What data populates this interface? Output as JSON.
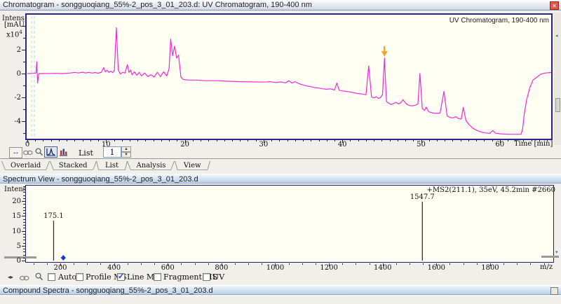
{
  "chromatogram_pane": {
    "title": "Chromatogram - songguoqiang_55%-2_pos_3_01_203.d: UV Chromatogram, 190-400 nm",
    "close_glyph": "✕",
    "plot_label": "UV Chromatogram, 190-400 nm",
    "y_label_1": "Intens.",
    "y_label_2": "[mAU]",
    "y_scale_base": "x10",
    "y_scale_exp": "4",
    "x_label": "Time [min]",
    "toolbar": {
      "list_label": "List",
      "list_value": "1"
    },
    "tabs": [
      "Overlaid",
      "Stacked",
      "List",
      "Analysis",
      "View"
    ]
  },
  "spectrum_pane": {
    "title": "Spectrum View - songguoqiang_55%-2_pos_3_01_203.d",
    "y_label": "Intens.",
    "x_label": "m/z",
    "annotation": "+MS2(211.1), 35eV, 45.2min #2660",
    "checkboxes": [
      {
        "label": "Auto",
        "checked": false
      },
      {
        "label": "Profile MS",
        "checked": false
      },
      {
        "label": "Line MS",
        "checked": true
      },
      {
        "label": "Fragment MS",
        "checked": false
      },
      {
        "label": "UV",
        "checked": false
      }
    ]
  },
  "compound_bar": {
    "title": "Compound Spectra - songguoqiang_55%-2_pos_3_01_203.d"
  },
  "colors": {
    "trace": "#ee2bd6",
    "peak_line": "#333333",
    "marker_orange": "#f0a32f",
    "precursor_blue": "#1838c8",
    "selection_dash": "#a9dcf0"
  },
  "chart_data": [
    {
      "type": "line",
      "title": "UV Chromatogram, 190-400 nm",
      "xlabel": "Time [min]",
      "ylabel": "Intens. [mAU] x10^4",
      "xlim": [
        0,
        66.6
      ],
      "ylim": [
        -5.5,
        5.0
      ],
      "x_ticks": [
        0,
        10,
        20,
        30,
        40,
        50,
        60
      ],
      "x_minor_step": 1,
      "y_tick_labels": [
        2,
        0,
        -2,
        -4
      ],
      "y_major_ticks": [
        4,
        2,
        0,
        -2,
        -4
      ],
      "y_minor_step": 1,
      "selection_lines_time": [
        0.53,
        0.89
      ],
      "marker": {
        "time": 45.35,
        "value": 1.3,
        "type": "fragmentation-marker"
      },
      "series": [
        {
          "name": "UV 190-400 nm",
          "points": [
            [
              0,
              0
            ],
            [
              0.8,
              0.02
            ],
            [
              1.1,
              0.05
            ],
            [
              1.2,
              1.0
            ],
            [
              1.3,
              -0.8
            ],
            [
              1.45,
              0
            ],
            [
              2.5,
              0
            ],
            [
              3.5,
              0.02
            ],
            [
              4.5,
              0
            ],
            [
              5.5,
              0.05
            ],
            [
              6,
              0.1
            ],
            [
              6.5,
              0.05
            ],
            [
              7,
              0.12
            ],
            [
              7.4,
              0.05
            ],
            [
              7.8,
              0.1
            ],
            [
              8.2,
              0.04
            ],
            [
              8.6,
              0.08
            ],
            [
              9,
              0.03
            ],
            [
              9.4,
              0.12
            ],
            [
              9.7,
              0.5
            ],
            [
              9.9,
              0.15
            ],
            [
              10.1,
              0.28
            ],
            [
              10.35,
              0.1
            ],
            [
              10.6,
              0.2
            ],
            [
              10.85,
              0.08
            ],
            [
              11.05,
              0.25
            ],
            [
              11.3,
              3.85
            ],
            [
              11.55,
              0.3
            ],
            [
              11.8,
              -0.05
            ],
            [
              12.1,
              0.1
            ],
            [
              12.4,
              0.05
            ],
            [
              12.7,
              0.75
            ],
            [
              12.9,
              0.1
            ],
            [
              13.1,
              0.3
            ],
            [
              13.3,
              -0.1
            ],
            [
              13.6,
              0.15
            ],
            [
              13.9,
              -0.15
            ],
            [
              14.2,
              0.1
            ],
            [
              14.5,
              -0.2
            ],
            [
              14.9,
              0.05
            ],
            [
              15.3,
              -0.25
            ],
            [
              15.7,
              -0.1
            ],
            [
              16.1,
              -0.3
            ],
            [
              16.5,
              0.1
            ],
            [
              16.9,
              -0.25
            ],
            [
              17.3,
              0.15
            ],
            [
              17.7,
              -0.2
            ],
            [
              18.0,
              0.4
            ],
            [
              18.2,
              2.9
            ],
            [
              18.45,
              1.5
            ],
            [
              18.7,
              2.3
            ],
            [
              18.95,
              1.3
            ],
            [
              19.2,
              1.55
            ],
            [
              19.5,
              -0.3
            ],
            [
              19.8,
              -0.5
            ],
            [
              20.5,
              -0.55
            ],
            [
              21.5,
              -0.55
            ],
            [
              22.5,
              -0.6
            ],
            [
              24,
              -0.6
            ],
            [
              25.5,
              -0.65
            ],
            [
              27,
              -0.68
            ],
            [
              28.5,
              -0.7
            ],
            [
              30,
              -0.72
            ],
            [
              30.8,
              -0.68
            ],
            [
              31.6,
              -0.75
            ],
            [
              32.2,
              -0.7
            ],
            [
              32.8,
              -0.78
            ],
            [
              33.2,
              -0.6
            ],
            [
              33.6,
              -0.8
            ],
            [
              34,
              -0.68
            ],
            [
              34.5,
              -0.85
            ],
            [
              35,
              -0.95
            ],
            [
              35.5,
              -1.05
            ],
            [
              36,
              -1.1
            ],
            [
              36.5,
              -1.18
            ],
            [
              37,
              -1.22
            ],
            [
              37.5,
              -1.28
            ],
            [
              38,
              -1.32
            ],
            [
              38.5,
              -1.28
            ],
            [
              39,
              -1.38
            ],
            [
              39.3,
              -0.8
            ],
            [
              39.6,
              -1.4
            ],
            [
              40,
              -1.45
            ],
            [
              40.5,
              -1.5
            ],
            [
              41,
              -1.55
            ],
            [
              41.5,
              -1.62
            ],
            [
              42,
              -1.68
            ],
            [
              42.5,
              -1.72
            ],
            [
              43,
              -1.78
            ],
            [
              43.35,
              0.65
            ],
            [
              43.7,
              -1.95
            ],
            [
              44,
              -2.05
            ],
            [
              44.3,
              -1.95
            ],
            [
              44.6,
              -2.1
            ],
            [
              44.85,
              -2.0
            ],
            [
              45.1,
              -1.75
            ],
            [
              45.35,
              1.3
            ],
            [
              45.6,
              -2.35
            ],
            [
              45.9,
              -2.5
            ],
            [
              46.2,
              -2.6
            ],
            [
              46.5,
              -2.52
            ],
            [
              46.8,
              -2.42
            ],
            [
              47.1,
              -2.55
            ],
            [
              47.4,
              -2.45
            ],
            [
              47.7,
              -2.2
            ],
            [
              48.1,
              -2.55
            ],
            [
              48.5,
              -2.68
            ],
            [
              48.9,
              -2.72
            ],
            [
              49.3,
              -2.65
            ],
            [
              49.6,
              -2.55
            ],
            [
              49.85,
              0.0
            ],
            [
              50.15,
              -2.95
            ],
            [
              50.45,
              -3.1
            ],
            [
              50.65,
              -2.82
            ],
            [
              50.95,
              -3.2
            ],
            [
              51.4,
              -3.3
            ],
            [
              51.9,
              -3.35
            ],
            [
              52.4,
              -3.32
            ],
            [
              52.9,
              -1.5
            ],
            [
              53.3,
              -3.55
            ],
            [
              53.7,
              -3.7
            ],
            [
              54.1,
              -3.72
            ],
            [
              54.4,
              -3.62
            ],
            [
              54.75,
              -3.78
            ],
            [
              55.1,
              -3.82
            ],
            [
              55.35,
              -2.85
            ],
            [
              55.7,
              -3.95
            ],
            [
              56.1,
              -4.3
            ],
            [
              56.6,
              -4.6
            ],
            [
              57.1,
              -4.78
            ],
            [
              57.6,
              -4.9
            ],
            [
              58.1,
              -4.98
            ],
            [
              58.7,
              -5.02
            ],
            [
              59.1,
              -4.78
            ],
            [
              59.4,
              -5.0
            ],
            [
              60,
              -5.06
            ],
            [
              61,
              -5.1
            ],
            [
              62,
              -5.1
            ],
            [
              62.7,
              -5.1
            ],
            [
              62.9,
              -4.6
            ],
            [
              63.1,
              -3.4
            ],
            [
              63.4,
              -2.2
            ],
            [
              63.8,
              -1.2
            ],
            [
              64.2,
              -0.55
            ],
            [
              64.7,
              -0.3
            ],
            [
              65.2,
              -0.05
            ],
            [
              65.8,
              0.05
            ],
            [
              66.4,
              0.08
            ],
            [
              66.6,
              0.08
            ]
          ]
        }
      ]
    },
    {
      "type": "bar",
      "title": "+MS2(211.1), 35eV, 45.2min #2660",
      "xlabel": "m/z",
      "ylabel": "Intens.",
      "xlim": [
        70,
        2040
      ],
      "ylim": [
        0,
        25
      ],
      "x_ticks": [
        200,
        400,
        600,
        800,
        1000,
        1200,
        1400,
        1600,
        1800
      ],
      "x_minor_step": 50,
      "y_ticks": [
        0,
        5,
        10,
        15,
        20
      ],
      "y_minor_step": 1,
      "peaks": [
        {
          "mz": 175.1,
          "intensity": 13.4,
          "label": "175.1"
        },
        {
          "mz": 1547.7,
          "intensity": 19.8,
          "label": "1547.7"
        }
      ],
      "precursor_mz": 211.1
    }
  ]
}
